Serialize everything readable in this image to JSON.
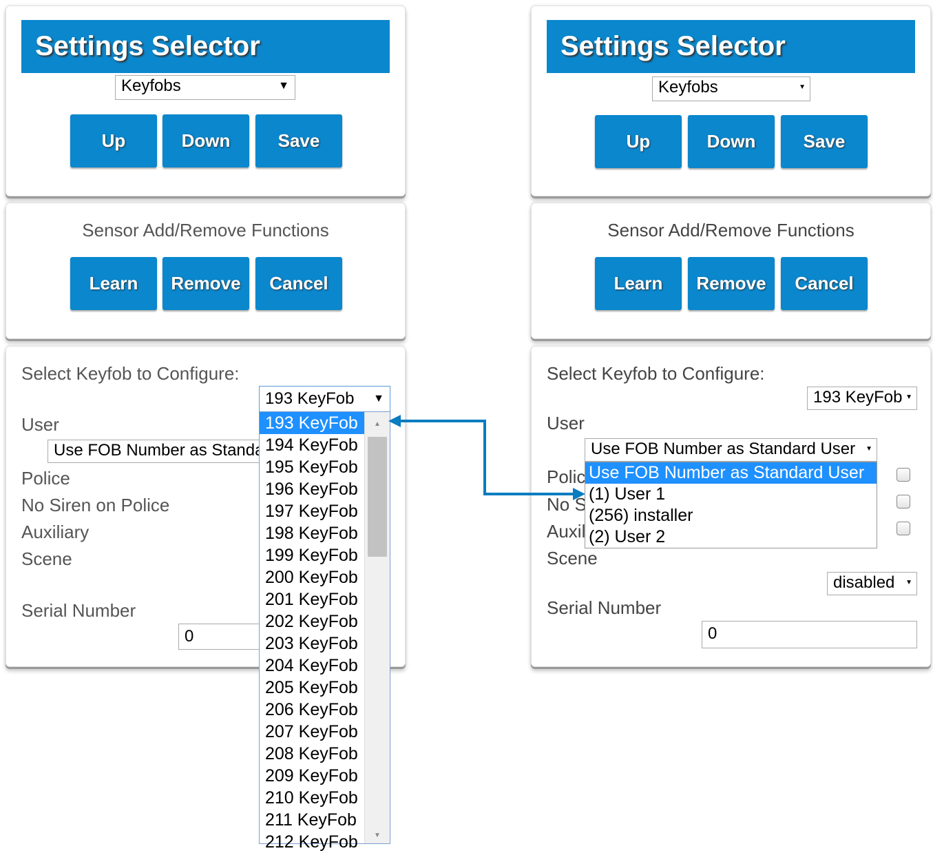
{
  "left": {
    "settings": {
      "title": "Settings Selector",
      "selector_value": "Keyfobs",
      "buttons": [
        "Up",
        "Down",
        "Save"
      ]
    },
    "sensor": {
      "title": "Sensor Add/Remove Functions",
      "buttons": [
        "Learn",
        "Remove",
        "Cancel"
      ]
    },
    "config": {
      "title": "Select Keyfob to Configure:",
      "keyfob_value": "193 KeyFob",
      "user_label": "User",
      "user_value": "Use FOB Number as Standard User",
      "police_label": "Police",
      "no_siren_label": "No Siren on Police",
      "auxiliary_label": "Auxiliary",
      "scene_label": "Scene",
      "serial_label": "Serial Number",
      "serial_value": "0"
    },
    "keyfob_options": [
      "193 KeyFob",
      "194 KeyFob",
      "195 KeyFob",
      "196 KeyFob",
      "197 KeyFob",
      "198 KeyFob",
      "199 KeyFob",
      "200 KeyFob",
      "201 KeyFob",
      "202 KeyFob",
      "203 KeyFob",
      "204 KeyFob",
      "205 KeyFob",
      "206 KeyFob",
      "207 KeyFob",
      "208 KeyFob",
      "209 KeyFob",
      "210 KeyFob",
      "211 KeyFob",
      "212 KeyFob"
    ],
    "keyfob_selected_index": 0
  },
  "right": {
    "settings": {
      "title": "Settings Selector",
      "selector_value": "Keyfobs",
      "buttons": [
        "Up",
        "Down",
        "Save"
      ]
    },
    "sensor": {
      "title": "Sensor Add/Remove Functions",
      "buttons": [
        "Learn",
        "Remove",
        "Cancel"
      ]
    },
    "config": {
      "title": "Select Keyfob to Configure:",
      "keyfob_value": "193 KeyFob",
      "user_label": "User",
      "user_value": "Use FOB Number as Standard User",
      "police_label_visible": "Polic",
      "no_siren_label_visible": "No S",
      "auxiliary_label_visible": "Auxil",
      "scene_label": "Scene",
      "scene_value": "disabled",
      "serial_label": "Serial Number",
      "serial_value": "0"
    },
    "user_options": [
      "Use FOB Number as Standard User",
      "(1) User 1",
      "(256) installer",
      "(2) User 2"
    ],
    "user_selected_index": 0
  },
  "colors": {
    "accent": "#0a87cd",
    "highlight": "#1e90ff",
    "label_text": "#555555"
  }
}
